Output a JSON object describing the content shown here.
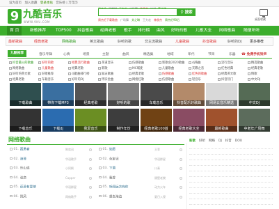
{
  "topbar": {
    "items": [
      "设为首页",
      "加入收藏",
      "登录本站",
      "音乐榜 | 万年历"
    ]
  },
  "brand": {
    "logo_char": "9",
    "title": "九酷音乐",
    "subtitle": "WWW.9KU.COM",
    "color": "#3cae2c"
  },
  "search": {
    "hot_links": [
      "周杰伦",
      "邓紫棋",
      "王力宏",
      "广场舞",
      "林俊杰",
      "冰封",
      "薛之谦"
    ],
    "placeholder": "",
    "button_label": "搜索",
    "suggestions": [
      "周杰伦下载歌曲",
      "广场舞",
      "关之琳",
      "王力宏",
      "林俊杰",
      "周杰伦90后"
    ]
  },
  "desktop": {
    "icon": "monitor-icon",
    "label": "桌面收藏"
  },
  "nav": {
    "items": [
      "首 页",
      "新歌推荐",
      "TOP500",
      "抖音歌曲",
      "经典老歌",
      "歌手",
      "排行榜",
      "曲风",
      "好听的歌",
      "儿歌大全",
      "网络歌曲",
      "随便听听"
    ]
  },
  "subnav": {
    "items": [
      "最新歌曲",
      "经典老歌",
      "网络歌曲",
      "英文歌曲",
      "好听的歌",
      "非主流歌曲",
      "儿童歌曲",
      "抖音歌曲",
      "好听的DJ",
      "更多推荐"
    ]
  },
  "categories": {
    "tabs": [
      "九酷推荐",
      "音乐专辑",
      "心情",
      "场景",
      "主题",
      "曲风",
      "精选集",
      "地域",
      "年代",
      "节目",
      "乐器"
    ],
    "right_link": "免费手机铃声",
    "rows": [
      [
        "抖音最火的歌曲",
        "好听的歌",
        "经典流行歌曲",
        "茶道音乐",
        "伤感歌曲",
        "新歌会2020歌曲",
        "dj嗨曲",
        "流行音乐",
        "精选歌曲"
      ],
      [
        "网络歌曲",
        "儿童歌曲",
        "经典老歌",
        "新歌",
        "MC喊麦",
        "儿童歌曲",
        "天籁之音",
        "红色经典",
        "经典老歌"
      ],
      [
        "好听的英文歌",
        "好歌推荐",
        "dj歌曲排行榜",
        "励志歌曲",
        "经典老歌",
        "伤感歌曲",
        "红色的歌曲",
        "经典英文歌",
        "情歌"
      ],
      [
        "经典老歌",
        "车载音乐",
        "好听的DJ",
        "怀旧金曲",
        "网络红歌",
        "伤感歌曲",
        "轻音乐",
        "抖音热门",
        "中文DJ"
      ]
    ]
  },
  "thumbs_row1": [
    "下载歌曲",
    "带你下载MP3",
    "经典老歌",
    "好听的歌",
    "车载音乐",
    "抖音配乐好歌曲",
    "网易云音乐精选",
    "中文DJ"
  ],
  "thumbs_row2": [
    "下载音乐",
    "下载dj",
    "我爱音乐",
    "制作年份",
    "经典老歌100首",
    "经典老歌大全",
    "最新歌曲",
    "中老年广场舞"
  ],
  "network": {
    "title": "网络歌曲",
    "col1": [
      {
        "no": "01.",
        "title": "孤勇者",
        "artist": "陈奕迅",
        "style": "r"
      },
      {
        "no": "02.",
        "title": "浪哥",
        "artist": "华语歌手",
        "style": "g"
      },
      {
        "no": "03.",
        "title": "乐山谣",
        "artist": "小阿枫",
        "style": "n"
      },
      {
        "no": "04.",
        "title": "谈恋",
        "artist": "Capper",
        "style": "n"
      },
      {
        "no": "05.",
        "title": "还没有爱够",
        "artist": "华语群星",
        "style": "r"
      },
      {
        "no": "06.",
        "title": "残风",
        "artist": "网络歌手",
        "style": "n"
      }
    ],
    "col2": [
      {
        "no": "01.",
        "title": "如愿",
        "artist": "王菲",
        "style": "t"
      },
      {
        "no": "02.",
        "title": "永定记",
        "artist": "华语群星",
        "style": "n"
      },
      {
        "no": "03.",
        "title": "下潜",
        "artist": "川青",
        "style": "t"
      },
      {
        "no": "04.",
        "title": "我曾",
        "artist": "隔壁老樊",
        "style": "n"
      },
      {
        "no": "05.",
        "title": "听闻远方有你",
        "artist": "动力火车",
        "style": "t"
      },
      {
        "no": "06.",
        "title": "想去海边",
        "artist": "夏日入侵",
        "style": "n"
      }
    ]
  },
  "ranking": {
    "tabs": [
      "新歌",
      "好听",
      "网络",
      "DJ",
      "抖音",
      "DOU"
    ],
    "rows": 11
  }
}
